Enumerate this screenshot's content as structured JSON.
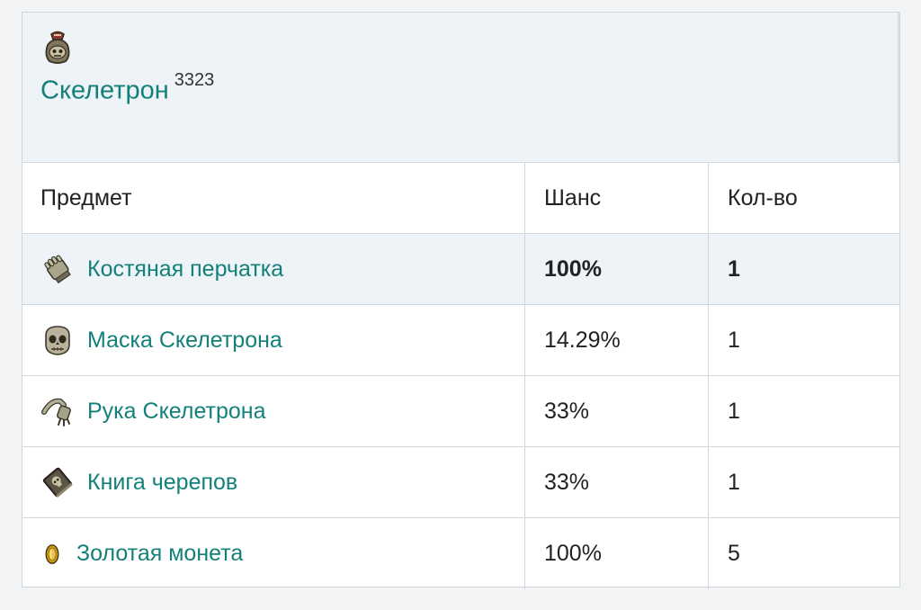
{
  "boss": {
    "name": "Скелетрон",
    "ref": "3323",
    "icon": "treasure-bag-icon"
  },
  "table": {
    "headers": {
      "item": "Предмет",
      "chance": "Шанс",
      "qty": "Кол-во"
    },
    "rows": [
      {
        "icon": "bone-glove-icon",
        "name": "Костяная перчатка",
        "chance": "100%",
        "qty": "1"
      },
      {
        "icon": "skeletron-mask-icon",
        "name": "Маска Скелетрона",
        "chance": "14.29%",
        "qty": "1"
      },
      {
        "icon": "skeletron-hand-icon",
        "name": "Рука Скелетрона",
        "chance": "33%",
        "qty": "1"
      },
      {
        "icon": "book-of-skulls-icon",
        "name": "Книга черепов",
        "chance": "33%",
        "qty": "1"
      },
      {
        "icon": "gold-coin-icon",
        "name": "Золотая монета",
        "chance": "100%",
        "qty": "5"
      }
    ]
  },
  "colors": {
    "link": "#14807a",
    "header_bg": "#eef3f7",
    "border": "#cfd7dc"
  }
}
